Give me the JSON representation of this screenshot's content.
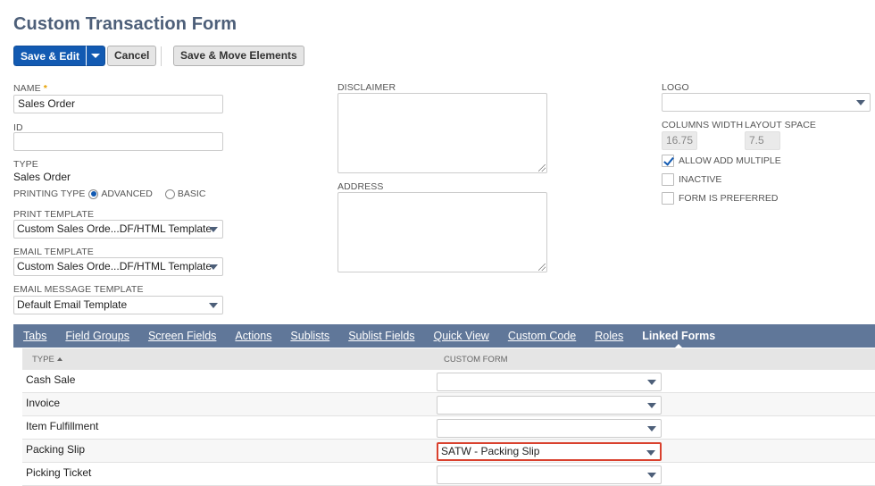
{
  "page": {
    "title": "Custom Transaction Form"
  },
  "toolbar": {
    "save_edit": "Save & Edit",
    "cancel": "Cancel",
    "save_move": "Save & Move Elements"
  },
  "form": {
    "name_label": "NAME",
    "name_required": "*",
    "name_value": "Sales Order",
    "id_label": "ID",
    "id_value": "",
    "type_label": "TYPE",
    "type_value": "Sales Order",
    "printing_type_label": "PRINTING TYPE",
    "printing_options": [
      "ADVANCED",
      "BASIC"
    ],
    "printing_selected": "ADVANCED",
    "print_template_label": "PRINT TEMPLATE",
    "print_template_value": "Custom Sales Orde...DF/HTML Template",
    "email_template_label": "EMAIL TEMPLATE",
    "email_template_value": "Custom Sales Orde...DF/HTML Template",
    "email_msg_label": "EMAIL MESSAGE TEMPLATE",
    "email_msg_value": "Default Email Template",
    "disclaimer_label": "DISCLAIMER",
    "address_label": "ADDRESS",
    "logo_label": "LOGO",
    "logo_value": "",
    "columns_width_label": "COLUMNS WIDTH",
    "columns_width_value": "16.75",
    "layout_space_label": "LAYOUT SPACE",
    "layout_space_value": "7.5",
    "checkboxes": [
      {
        "label": "ALLOW ADD MULTIPLE",
        "checked": true
      },
      {
        "label": "INACTIVE",
        "checked": false
      },
      {
        "label": "FORM IS PREFERRED",
        "checked": false
      }
    ]
  },
  "tabs": [
    {
      "label": "Tabs",
      "active": false
    },
    {
      "label": "Field Groups",
      "active": false
    },
    {
      "label": "Screen Fields",
      "active": false
    },
    {
      "label": "Actions",
      "active": false
    },
    {
      "label": "Sublists",
      "active": false
    },
    {
      "label": "Sublist Fields",
      "active": false
    },
    {
      "label": "Quick View",
      "active": false
    },
    {
      "label": "Custom Code",
      "active": false
    },
    {
      "label": "Roles",
      "active": false
    },
    {
      "label": "Linked Forms",
      "active": true
    }
  ],
  "linked_forms": {
    "headers": [
      "TYPE",
      "CUSTOM FORM"
    ],
    "rows": [
      {
        "type": "Cash Sale",
        "custom_form": ""
      },
      {
        "type": "Invoice",
        "custom_form": ""
      },
      {
        "type": "Item Fulfillment",
        "custom_form": ""
      },
      {
        "type": "Packing Slip",
        "custom_form": "SATW - Packing Slip",
        "highlighted": true
      },
      {
        "type": "Picking Ticket",
        "custom_form": ""
      }
    ]
  },
  "colors": {
    "primary_button": "#125ab2",
    "title": "#4d5f79",
    "tab_bar": "#607799",
    "highlight_border": "#d9412e",
    "required_mark": "#e7a100"
  }
}
